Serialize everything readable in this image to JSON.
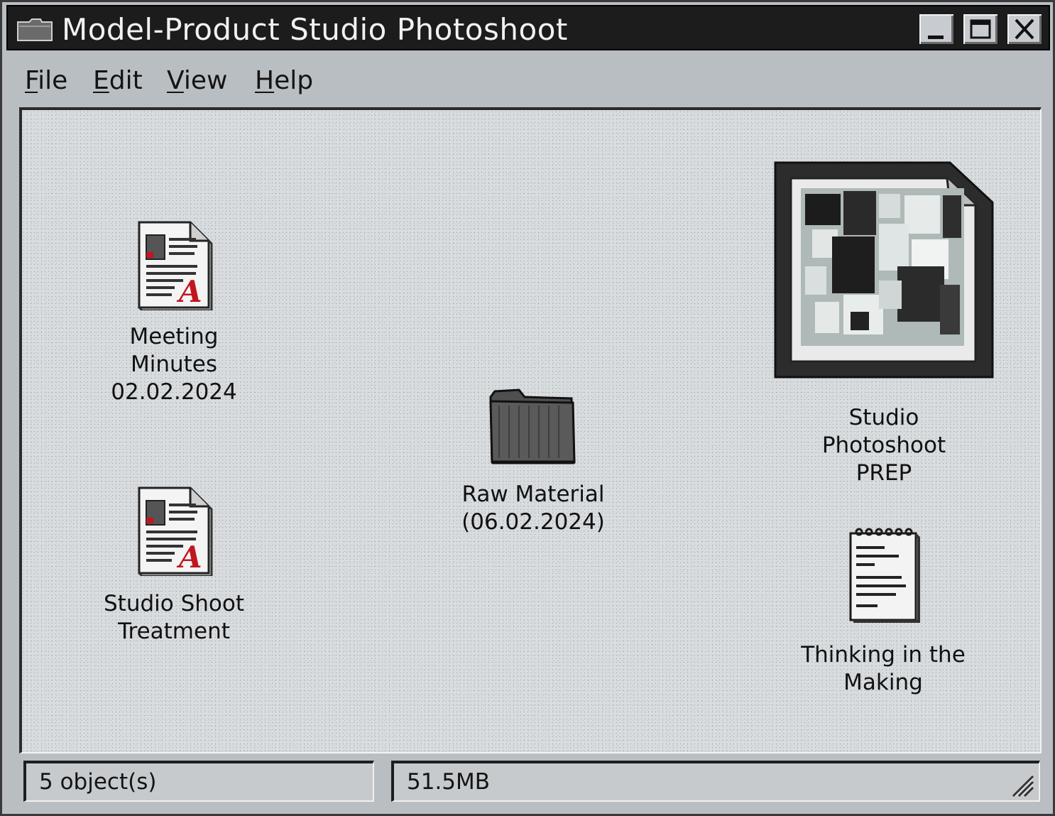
{
  "window": {
    "title": "Model-Product Studio Photoshoot",
    "icon": "folder-icon",
    "controls": {
      "minimize": "minimize-icon",
      "maximize": "maximize-icon",
      "close": "close-icon"
    }
  },
  "menu": {
    "items": [
      {
        "accel": "F",
        "rest": "ile"
      },
      {
        "accel": "E",
        "rest": "dit"
      },
      {
        "accel": "V",
        "rest": "iew"
      },
      {
        "accel": "H",
        "rest": "elp"
      }
    ]
  },
  "items": [
    {
      "label": "Meeting\nMinutes\n02.02.2024",
      "icon": "pdf-document-icon"
    },
    {
      "label": "Studio Shoot\nTreatment",
      "icon": "pdf-document-icon"
    },
    {
      "label": "Raw Material\n(06.02.2024)",
      "icon": "folder-icon"
    },
    {
      "label": "Studio\nPhotoshoot\nPREP",
      "icon": "image-collage-file-icon"
    },
    {
      "label": "Thinking in the\nMaking",
      "icon": "notepad-icon"
    }
  ],
  "status": {
    "objects": "5 object(s)",
    "size": "51.5MB",
    "grip": "resize-grip-icon"
  },
  "colors": {
    "titlebar": "#1c1c1c",
    "window": "#b9bec3",
    "content": "#d8dcdf",
    "pdf_accent": "#c0161f"
  }
}
